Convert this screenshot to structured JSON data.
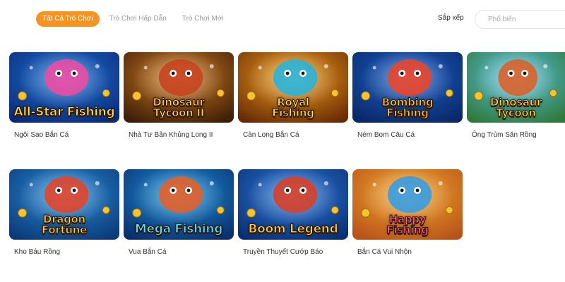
{
  "filters": {
    "tabs": [
      {
        "label": "Tất Cả Trò Chơi",
        "active": true
      },
      {
        "label": "Trò Chơi Hấp Dẫn",
        "active": false
      },
      {
        "label": "Trò Chơi Mới",
        "active": false
      }
    ],
    "sort_label": "Sắp xếp",
    "sort_value": "Phổ biến"
  },
  "games": [
    {
      "thumb_title": "All-Star",
      "thumb_subtitle": "Fishing",
      "name": "Ngôi Sao Bắn Cá",
      "palette": {
        "bg1": "#1c6fd1",
        "bg2": "#0b2a7a",
        "accent": "#e84da4",
        "text": "#ffe23a"
      }
    },
    {
      "thumb_title": "Dinosaur Tycoon",
      "thumb_subtitle": "II",
      "name": "Nhà Tư Bản Khủng Long II",
      "palette": {
        "bg1": "#d17a1f",
        "bg2": "#3d1e08",
        "accent": "#c7441f",
        "text": "#ffd56b"
      }
    },
    {
      "thumb_title": "Royal Fishing",
      "thumb_subtitle": "",
      "name": "Càn Long Bắn Cá",
      "palette": {
        "bg1": "#f0a01c",
        "bg2": "#6a2a05",
        "accent": "#2bb3d8",
        "text": "#ffe066"
      }
    },
    {
      "thumb_title": "Bombing Fishing",
      "thumb_subtitle": "",
      "name": "Ném Bom Câu Cá",
      "palette": {
        "bg1": "#1a60c9",
        "bg2": "#0a2866",
        "accent": "#e8452c",
        "text": "#ffca3a"
      }
    },
    {
      "thumb_title": "Dinosaur Tycoon",
      "thumb_subtitle": "",
      "name": "Ông Trùm Săn Rồng",
      "palette": {
        "bg1": "#5cc0e8",
        "bg2": "#2f7a3a",
        "accent": "#d9622b",
        "text": "#ffd84a"
      }
    },
    {
      "thumb_title": "Dragon Fortune",
      "thumb_subtitle": "",
      "name": "Kho Báu Rồng",
      "palette": {
        "bg1": "#2a8ad6",
        "bg2": "#0a3a78",
        "accent": "#e0452c",
        "text": "#ffd23a"
      }
    },
    {
      "thumb_title": "Mega Fishing",
      "thumb_subtitle": "",
      "name": "Vua Bắn Cá",
      "palette": {
        "bg1": "#1a8fd6",
        "bg2": "#0a2f6e",
        "accent": "#e0612a",
        "text": "#56e0ff"
      }
    },
    {
      "thumb_title": "Boom Legend",
      "thumb_subtitle": "",
      "name": "Truyền Thuyết Cướp Báo",
      "palette": {
        "bg1": "#2a78d8",
        "bg2": "#0b2e72",
        "accent": "#d6402a",
        "text": "#ffd23a"
      }
    },
    {
      "thumb_title": "Happy Fishing",
      "thumb_subtitle": "",
      "name": "Bắn Cá Vui Nhộn",
      "palette": {
        "bg1": "#f0a62a",
        "bg2": "#b8521a",
        "accent": "#3a9ce0",
        "text": "#ff5a9a"
      }
    }
  ]
}
